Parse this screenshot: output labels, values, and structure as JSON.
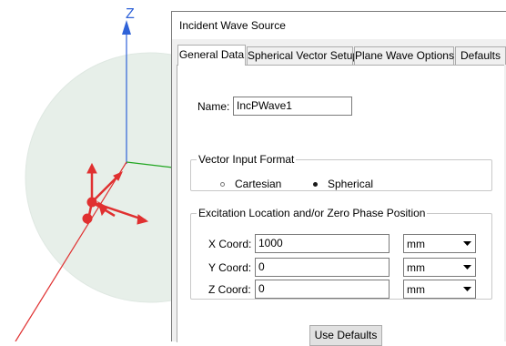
{
  "viewport": {
    "axis_z_label": "Z",
    "colors": {
      "z_axis": "#2f62d8",
      "y_axis": "#21a621",
      "x_axis": "#e03030",
      "sphere": "#e7efe9"
    }
  },
  "dialog": {
    "title": "Incident Wave Source",
    "tabs": [
      "General Data",
      "Spherical Vector Setup",
      "Plane Wave Options",
      "Defaults"
    ],
    "active_tab": "General Data",
    "name_label": "Name:",
    "name_value": "IncPWave1",
    "vector_group": {
      "legend": "Vector Input Format",
      "options": [
        "Cartesian",
        "Spherical"
      ],
      "selected": "Spherical"
    },
    "excitation_group": {
      "legend": "Excitation Location and/or Zero Phase Position",
      "rows": [
        {
          "label": "X Coord:",
          "value": "1000",
          "unit": "mm"
        },
        {
          "label": "Y Coord:",
          "value": "0",
          "unit": "mm"
        },
        {
          "label": "Z Coord:",
          "value": "0",
          "unit": "mm"
        }
      ]
    },
    "use_defaults_label": "Use Defaults"
  }
}
